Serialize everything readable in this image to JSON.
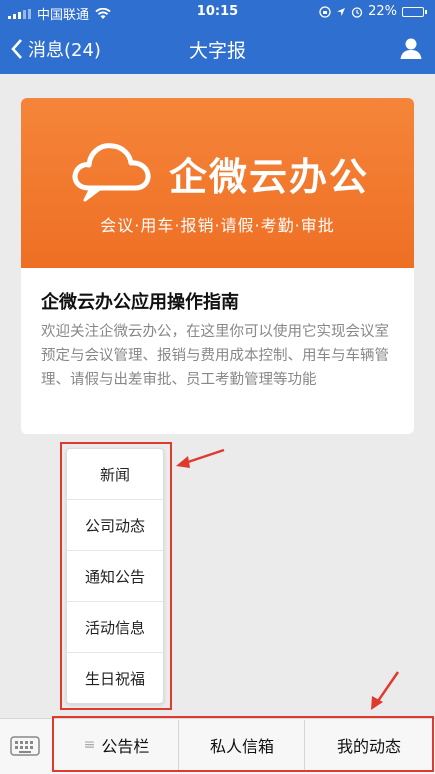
{
  "status_bar": {
    "carrier": "中国联通",
    "time": "10:15",
    "battery": "22%",
    "battery_level": 0.22
  },
  "nav": {
    "back_label": "消息(24)",
    "title": "大字报"
  },
  "article": {
    "banner_brand": "企微云办公",
    "banner_slogan": "会议·用车·报销·请假·考勤·审批",
    "title": "企微云办公应用操作指南",
    "description": "欢迎关注企微云办公，在这里你可以使用它实现会议室预定与会议管理、报销与费用成本控制、用车与车辆管理、请假与出差审批、员工考勤管理等功能"
  },
  "popup_menu": {
    "items": [
      "新闻",
      "公司动态",
      "通知公告",
      "活动信息",
      "生日祝福"
    ]
  },
  "bottom_menu": {
    "tabs": [
      "公告栏",
      "私人信箱",
      "我的动态"
    ],
    "tab_prefix_icon": "≡"
  },
  "colors": {
    "nav": "#2f6fd0",
    "banner": "#ee6f24",
    "highlight": "#e03a2f"
  }
}
